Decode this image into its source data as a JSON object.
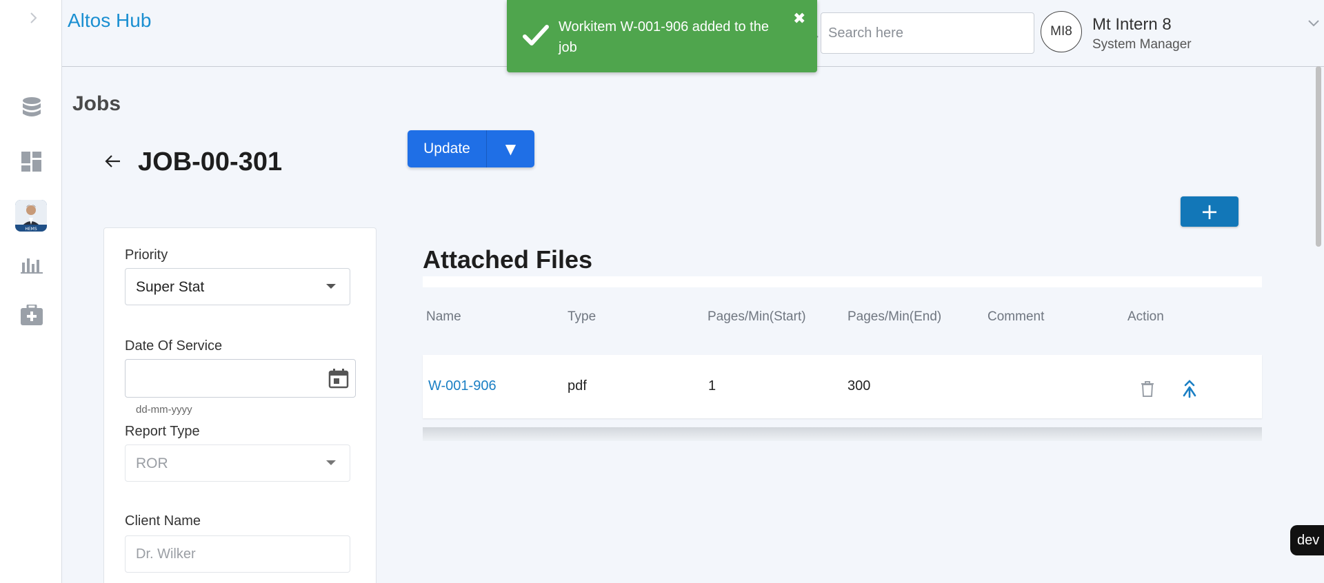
{
  "app": {
    "brand": "Altos Hub"
  },
  "header": {
    "search": {
      "placeholder": "Search here",
      "value": ""
    },
    "user": {
      "initials": "MI8",
      "name": "Mt Intern 8",
      "role": "System Manager"
    }
  },
  "toast": {
    "message": "Workitem W-001-906 added to the job",
    "close_glyph": "✖"
  },
  "page": {
    "title": "Jobs",
    "job_id": "JOB-00-301"
  },
  "actions": {
    "update_label": "Update",
    "dropdown_glyph": "▼",
    "add_glyph": "+"
  },
  "form": {
    "priority": {
      "label": "Priority",
      "value": "Super Stat"
    },
    "date_of_service": {
      "label": "Date Of Service",
      "value": "",
      "hint": "dd-mm-yyyy"
    },
    "report_type": {
      "label": "Report Type",
      "value": "ROR"
    },
    "client_name": {
      "label": "Client Name",
      "value": "Dr. Wilker"
    }
  },
  "files": {
    "title": "Attached Files",
    "columns": [
      "Name",
      "Type",
      "Pages/Min(Start)",
      "Pages/Min(End)",
      "Comment",
      "Action"
    ],
    "rows": [
      {
        "name": "W-001-906",
        "type": "pdf",
        "start": "1",
        "end": "300",
        "comment": ""
      }
    ]
  },
  "env_badge": "dev",
  "colors": {
    "brand": "#1a8fd1",
    "toast": "#4fa54d",
    "primary": "#1f6fe6",
    "add": "#1277b8"
  }
}
